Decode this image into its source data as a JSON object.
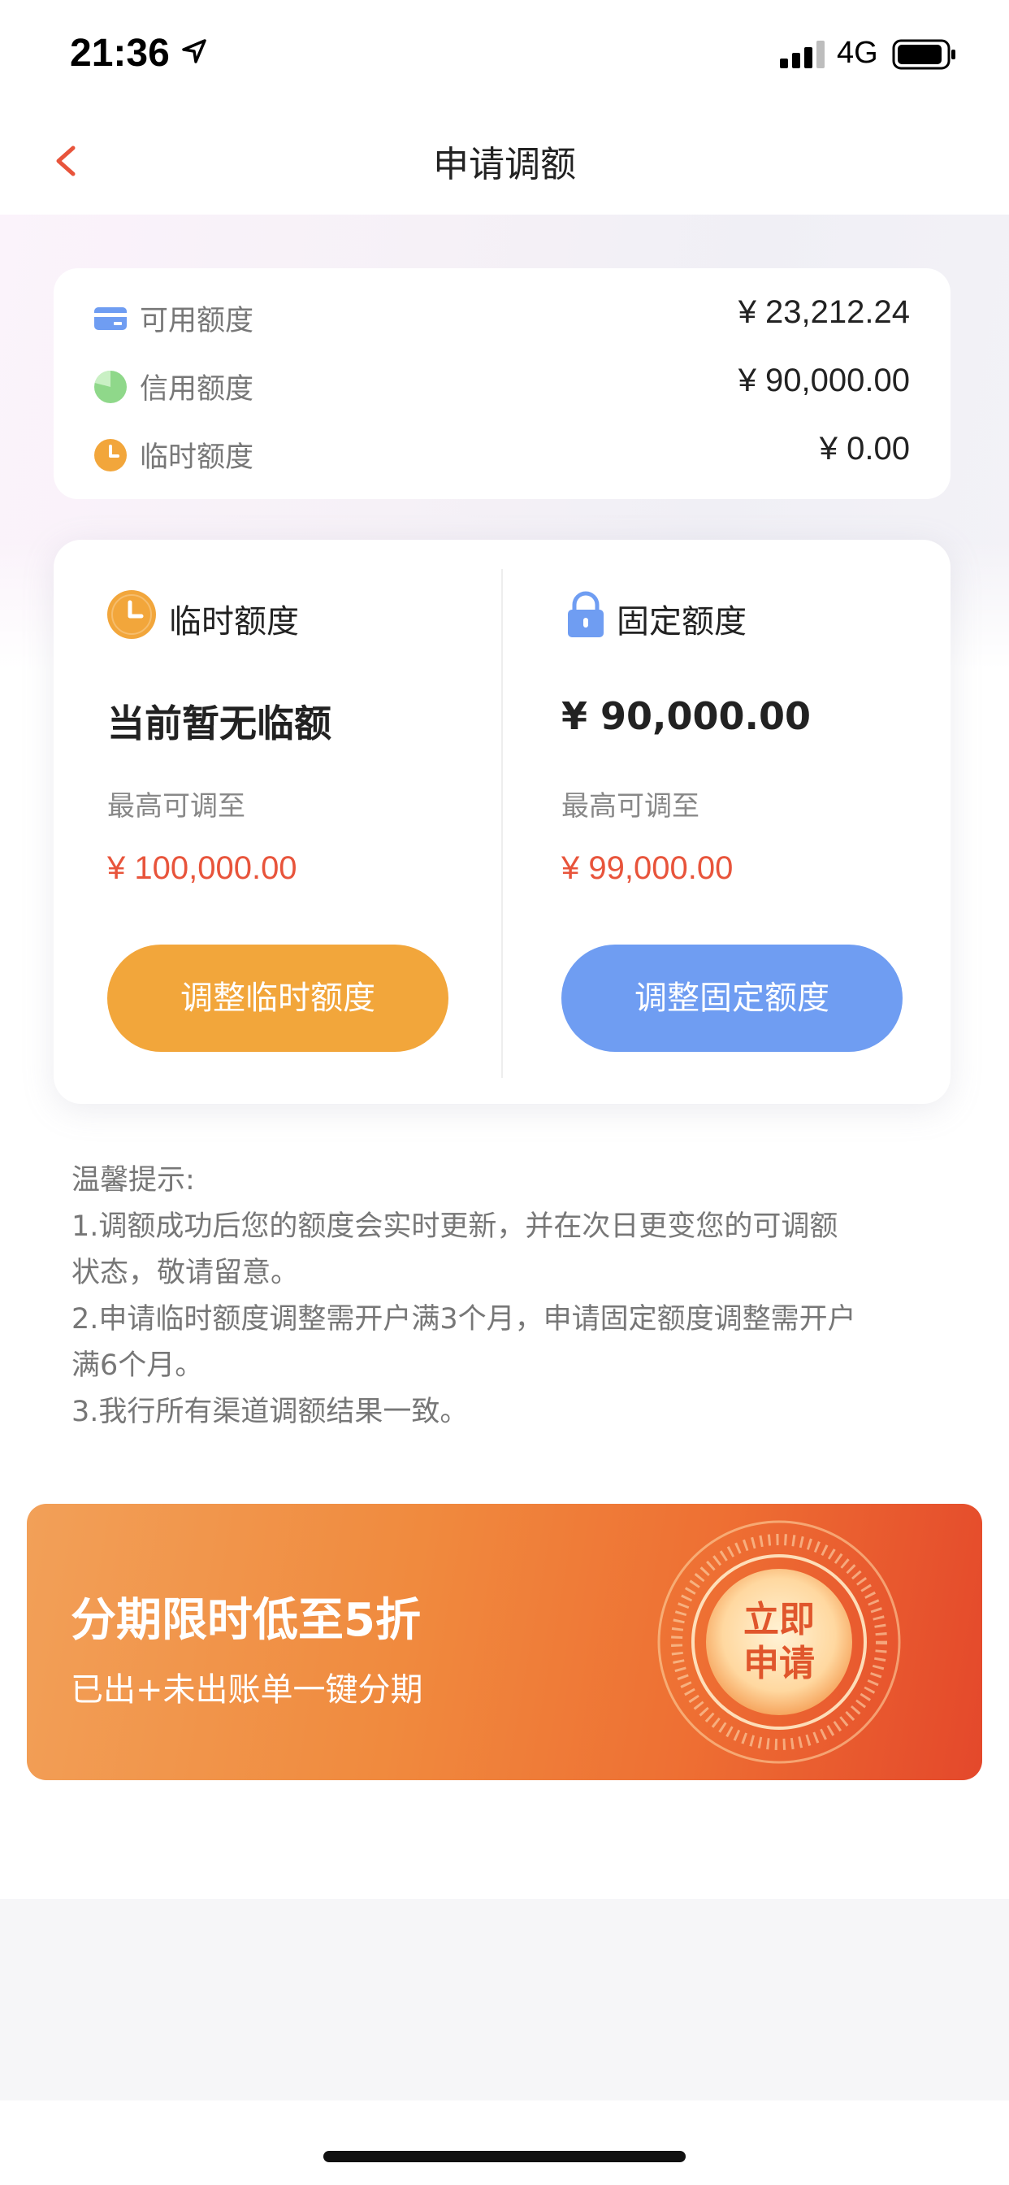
{
  "status_bar": {
    "time": "21:36",
    "network": "4G"
  },
  "nav": {
    "title": "申请调额"
  },
  "summary": [
    {
      "label": "可用额度",
      "value": "¥ 23,212.24",
      "icon": "card-icon",
      "color": "#6f9df2"
    },
    {
      "label": "信用额度",
      "value": "¥ 90,000.00",
      "icon": "pie-icon",
      "color": "#8fd88a"
    },
    {
      "label": "临时额度",
      "value": "¥ 0.00",
      "icon": "clock-icon",
      "color": "#f2a63b"
    }
  ],
  "temp_quota": {
    "title": "临时额度",
    "current": "当前暂无临额",
    "max_label": "最高可调至",
    "max_value": "¥ 100,000.00",
    "button": "调整临时额度"
  },
  "fixed_quota": {
    "title": "固定额度",
    "current": "¥ 90,000.00",
    "max_label": "最高可调至",
    "max_value": "¥ 99,000.00",
    "button": "调整固定额度"
  },
  "tips": {
    "heading": "温馨提示:",
    "lines": [
      "1.调额成功后您的额度会实时更新，并在次日更变您的可调额",
      "状态，敬请留意。",
      "2.申请临时额度调整需开户满3个月，申请固定额度调整需开户",
      "满6个月。",
      "3.我行所有渠道调额结果一致。"
    ]
  },
  "banner": {
    "title": "分期限时低至5折",
    "subtitle": "已出+未出账单一键分期",
    "badge_line1": "立即",
    "badge_line2": "申请"
  },
  "colors": {
    "accent_red": "#e8543b",
    "orange": "#f2a63b",
    "blue": "#6f9df2"
  }
}
